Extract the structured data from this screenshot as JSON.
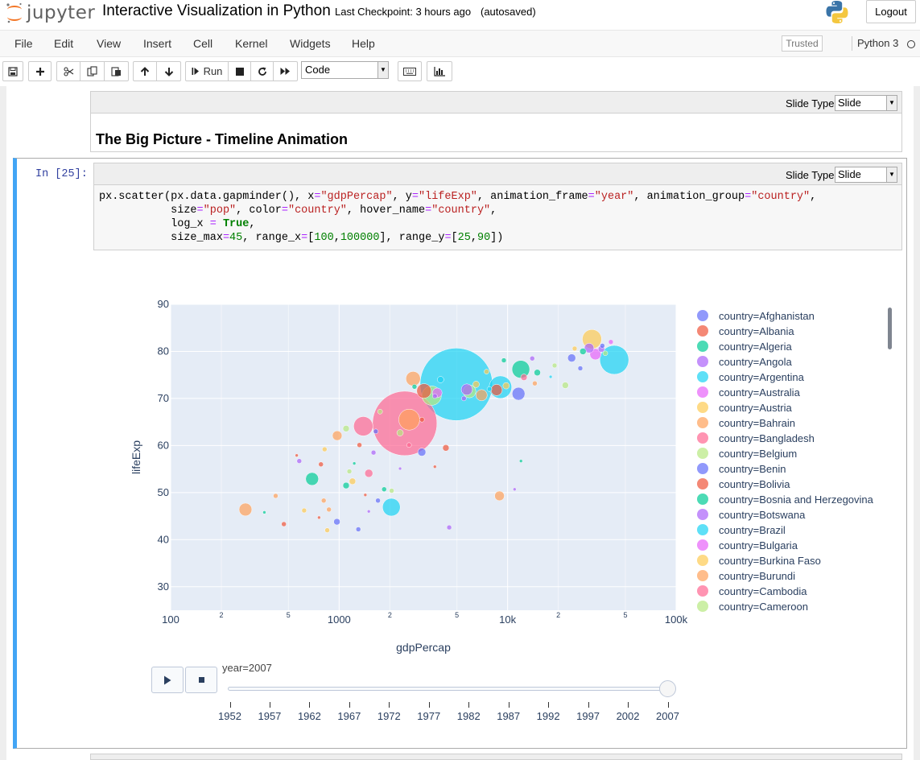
{
  "header": {
    "logo_text": "jupyter",
    "notebook_title": "Interactive Visualization in Python",
    "checkpoint": "Last Checkpoint: 3 hours ago",
    "autosave_status": "(autosaved)",
    "logout_label": "Logout"
  },
  "menubar": {
    "items": [
      "File",
      "Edit",
      "View",
      "Insert",
      "Cell",
      "Kernel",
      "Widgets",
      "Help"
    ],
    "trusted_label": "Trusted",
    "kernel_name": "Python 3"
  },
  "toolbar": {
    "run_label": "Run",
    "cell_type": "Code",
    "icons": [
      "save-icon",
      "plus-icon",
      "cut-icon",
      "copy-icon",
      "paste-icon",
      "arrow-up-icon",
      "arrow-down-icon",
      "step-forward-icon",
      "stop-icon",
      "restart-icon",
      "fast-forward-icon",
      "keyboard-icon",
      "bar-chart-icon"
    ]
  },
  "cells": {
    "markdown": {
      "slide_label": "Slide Type",
      "slide_value": "Slide",
      "heading": "The Big Picture - Timeline Animation"
    },
    "code": {
      "prompt": "In [25]:",
      "slide_label": "Slide Type",
      "slide_value": "Slide",
      "lines": [
        [
          [
            "",
            "px.scatter(px.data.gapminder(), x"
          ],
          [
            "op",
            "="
          ],
          [
            "str",
            "\"gdpPercap\""
          ],
          [
            "",
            ", y"
          ],
          [
            "op",
            "="
          ],
          [
            "str",
            "\"lifeExp\""
          ],
          [
            "",
            ", animation_frame"
          ],
          [
            "op",
            "="
          ],
          [
            "str",
            "\"year\""
          ],
          [
            "",
            ", animation_group"
          ],
          [
            "op",
            "="
          ],
          [
            "str",
            "\"country\""
          ],
          [
            "",
            ","
          ]
        ],
        [
          [
            "",
            "           size"
          ],
          [
            "op",
            "="
          ],
          [
            "str",
            "\"pop\""
          ],
          [
            "",
            ", color"
          ],
          [
            "op",
            "="
          ],
          [
            "str",
            "\"country\""
          ],
          [
            "",
            ", hover_name"
          ],
          [
            "op",
            "="
          ],
          [
            "str",
            "\"country\""
          ],
          [
            "",
            ","
          ]
        ],
        [
          [
            "",
            "           log_x "
          ],
          [
            "op",
            "="
          ],
          [
            "",
            " "
          ],
          [
            "kw",
            "True"
          ],
          [
            "",
            ","
          ]
        ],
        [
          [
            "",
            "           size_max"
          ],
          [
            "op",
            "="
          ],
          [
            "num",
            "45"
          ],
          [
            "",
            ", range_x"
          ],
          [
            "op",
            "="
          ],
          [
            "",
            "["
          ],
          [
            "num",
            "100"
          ],
          [
            "",
            ","
          ],
          [
            "num",
            "100000"
          ],
          [
            "",
            "], range_y"
          ],
          [
            "op",
            "="
          ],
          [
            "",
            "["
          ],
          [
            "num",
            "25"
          ],
          [
            "",
            ","
          ],
          [
            "num",
            "90"
          ],
          [
            "",
            "])"
          ]
        ]
      ]
    }
  },
  "chart_data": {
    "type": "scatter",
    "xlabel": "gdpPercap",
    "ylabel": "lifeExp",
    "x_scale": "log",
    "xlim": [
      100,
      100000
    ],
    "ylim": [
      25,
      90
    ],
    "x_major_ticks": [
      100,
      1000,
      10000,
      100000
    ],
    "x_major_tick_labels": [
      "100",
      "1000",
      "10k",
      "100k"
    ],
    "x_minor_ticks": [
      200,
      500,
      2000,
      5000,
      20000,
      50000
    ],
    "x_minor_tick_labels": [
      "2",
      "5",
      "2",
      "5",
      "2",
      "5"
    ],
    "y_ticks": [
      30,
      40,
      50,
      60,
      70,
      80,
      90
    ],
    "grid": true,
    "legend_placement": "right",
    "legend": [
      {
        "name": "country=Afghanistan",
        "color": "#636efa"
      },
      {
        "name": "country=Albania",
        "color": "#ef553b"
      },
      {
        "name": "country=Algeria",
        "color": "#00cc96"
      },
      {
        "name": "country=Angola",
        "color": "#ab63fa"
      },
      {
        "name": "country=Argentina",
        "color": "#19d3f3"
      },
      {
        "name": "country=Australia",
        "color": "#e763fa"
      },
      {
        "name": "country=Austria",
        "color": "#fecb52"
      },
      {
        "name": "country=Bahrain",
        "color": "#ffa15a"
      },
      {
        "name": "country=Bangladesh",
        "color": "#ff6692"
      },
      {
        "name": "country=Belgium",
        "color": "#b6e880"
      },
      {
        "name": "country=Benin",
        "color": "#636efa"
      },
      {
        "name": "country=Bolivia",
        "color": "#ef553b"
      },
      {
        "name": "country=Bosnia and Herzegovina",
        "color": "#00cc96"
      },
      {
        "name": "country=Botswana",
        "color": "#ab63fa"
      },
      {
        "name": "country=Brazil",
        "color": "#19d3f3"
      },
      {
        "name": "country=Bulgaria",
        "color": "#e763fa"
      },
      {
        "name": "country=Burkina Faso",
        "color": "#fecb52"
      },
      {
        "name": "country=Burundi",
        "color": "#ffa15a"
      },
      {
        "name": "country=Cambodia",
        "color": "#ff6692"
      },
      {
        "name": "country=Cameroon",
        "color": "#b6e880"
      }
    ],
    "points": [
      {
        "x": 4959,
        "y": 73.0,
        "s": 45,
        "c": "#19d3f3"
      },
      {
        "x": 2452,
        "y": 64.7,
        "s": 40,
        "c": "#ff6692"
      },
      {
        "x": 42952,
        "y": 78.2,
        "s": 18,
        "c": "#19d3f3"
      },
      {
        "x": 9065,
        "y": 72.4,
        "s": 14,
        "c": "#19d3f3"
      },
      {
        "x": 2605,
        "y": 65.5,
        "s": 13,
        "c": "#ffa15a"
      },
      {
        "x": 31656,
        "y": 82.6,
        "s": 12,
        "c": "#fecb52"
      },
      {
        "x": 3540,
        "y": 70.6,
        "s": 12,
        "c": "#b6e880"
      },
      {
        "x": 1391,
        "y": 64.1,
        "s": 12,
        "c": "#ff6692"
      },
      {
        "x": 11977,
        "y": 76.2,
        "s": 11,
        "c": "#00cc96"
      },
      {
        "x": 2042,
        "y": 46.9,
        "s": 11,
        "c": "#19d3f3"
      },
      {
        "x": 278,
        "y": 46.4,
        "s": 8,
        "c": "#ffa15a"
      },
      {
        "x": 2749,
        "y": 74.2,
        "s": 9,
        "c": "#ffa15a"
      },
      {
        "x": 11605,
        "y": 71.0,
        "s": 8,
        "c": "#636efa"
      },
      {
        "x": 691,
        "y": 52.9,
        "s": 8,
        "c": "#00cc96"
      },
      {
        "x": 3190,
        "y": 71.6,
        "s": 9,
        "c": "#ef553b"
      },
      {
        "x": 5937,
        "y": 71.5,
        "s": 8,
        "c": "#b6e880"
      },
      {
        "x": 7006,
        "y": 70.7,
        "s": 7,
        "c": "#ffa15a"
      },
      {
        "x": 33203,
        "y": 79.4,
        "s": 7,
        "c": "#e763fa"
      },
      {
        "x": 30470,
        "y": 80.7,
        "s": 6,
        "c": "#ab63fa"
      },
      {
        "x": 8605,
        "y": 71.8,
        "s": 7,
        "c": "#ef553b"
      },
      {
        "x": 974,
        "y": 62.1,
        "s": 6,
        "c": "#ffa15a"
      },
      {
        "x": 8948,
        "y": 49.3,
        "s": 6,
        "c": "#ffa15a"
      },
      {
        "x": 3822,
        "y": 71.2,
        "s": 6,
        "c": "#e763fa"
      },
      {
        "x": 5728,
        "y": 71.9,
        "s": 7,
        "c": "#ab63fa"
      },
      {
        "x": 24000,
        "y": 78.6,
        "s": 5,
        "c": "#636efa"
      },
      {
        "x": 3095,
        "y": 58.6,
        "s": 5,
        "c": "#636efa"
      },
      {
        "x": 4300,
        "y": 59.5,
        "s": 4,
        "c": "#ef553b"
      },
      {
        "x": 1100,
        "y": 51.5,
        "s": 4,
        "c": "#00cc96"
      },
      {
        "x": 1500,
        "y": 54.1,
        "s": 5,
        "c": "#ff6692"
      },
      {
        "x": 1200,
        "y": 52.4,
        "s": 4,
        "c": "#fecb52"
      },
      {
        "x": 1750,
        "y": 67.2,
        "s": 3,
        "c": "#b6e880"
      },
      {
        "x": 1100,
        "y": 63.6,
        "s": 4,
        "c": "#b6e880"
      },
      {
        "x": 2300,
        "y": 62.7,
        "s": 4,
        "c": "#b6e880"
      },
      {
        "x": 970,
        "y": 43.8,
        "s": 4,
        "c": "#636efa"
      },
      {
        "x": 1300,
        "y": 42.2,
        "s": 3,
        "c": "#636efa"
      },
      {
        "x": 850,
        "y": 42.0,
        "s": 3,
        "c": "#fecb52"
      },
      {
        "x": 1700,
        "y": 48.3,
        "s": 3,
        "c": "#636efa"
      },
      {
        "x": 2050,
        "y": 50.4,
        "s": 3,
        "c": "#b6e880"
      },
      {
        "x": 1600,
        "y": 58.5,
        "s": 3,
        "c": "#ab63fa"
      },
      {
        "x": 4500,
        "y": 42.6,
        "s": 3,
        "c": "#ab63fa"
      },
      {
        "x": 4000,
        "y": 74.0,
        "s": 4,
        "c": "#19d3f3"
      },
      {
        "x": 6500,
        "y": 73.0,
        "s": 4,
        "c": "#fecb52"
      },
      {
        "x": 9800,
        "y": 72.7,
        "s": 4,
        "c": "#fecb52"
      },
      {
        "x": 12500,
        "y": 74.5,
        "s": 4,
        "c": "#ff6692"
      },
      {
        "x": 14000,
        "y": 78.5,
        "s": 3,
        "c": "#ab63fa"
      },
      {
        "x": 15000,
        "y": 75.5,
        "s": 4,
        "c": "#00cc96"
      },
      {
        "x": 22000,
        "y": 72.8,
        "s": 4,
        "c": "#b6e880"
      },
      {
        "x": 28000,
        "y": 80.0,
        "s": 4,
        "c": "#00cc96"
      },
      {
        "x": 36000,
        "y": 80.5,
        "s": 4,
        "c": "#ab63fa"
      },
      {
        "x": 36500,
        "y": 81.2,
        "s": 3,
        "c": "#636efa"
      },
      {
        "x": 27000,
        "y": 76.4,
        "s": 3,
        "c": "#636efa"
      },
      {
        "x": 18000,
        "y": 74.6,
        "s": 2,
        "c": "#19d3f3"
      },
      {
        "x": 5500,
        "y": 70.0,
        "s": 3,
        "c": "#ab63fa"
      },
      {
        "x": 3700,
        "y": 70.5,
        "s": 3,
        "c": "#ab63fa"
      },
      {
        "x": 820,
        "y": 59.2,
        "s": 3,
        "c": "#fecb52"
      },
      {
        "x": 580,
        "y": 56.7,
        "s": 3,
        "c": "#ab63fa"
      },
      {
        "x": 780,
        "y": 56.0,
        "s": 3,
        "c": "#ef553b"
      },
      {
        "x": 470,
        "y": 43.3,
        "s": 3,
        "c": "#ef553b"
      },
      {
        "x": 760,
        "y": 44.7,
        "s": 2,
        "c": "#ef553b"
      },
      {
        "x": 870,
        "y": 46.4,
        "s": 3,
        "c": "#ffa15a"
      },
      {
        "x": 810,
        "y": 48.3,
        "s": 3,
        "c": "#ffa15a"
      },
      {
        "x": 420,
        "y": 49.3,
        "s": 3,
        "c": "#ffa15a"
      },
      {
        "x": 620,
        "y": 46.2,
        "s": 3,
        "c": "#fecb52"
      },
      {
        "x": 1150,
        "y": 54.5,
        "s": 3,
        "c": "#b6e880"
      },
      {
        "x": 1320,
        "y": 60.1,
        "s": 3,
        "c": "#ef553b"
      },
      {
        "x": 1650,
        "y": 63.0,
        "s": 3,
        "c": "#636efa"
      },
      {
        "x": 1850,
        "y": 50.7,
        "s": 3,
        "c": "#00cc96"
      },
      {
        "x": 2600,
        "y": 60.1,
        "s": 3,
        "c": "#ff6692"
      },
      {
        "x": 2800,
        "y": 72.5,
        "s": 3,
        "c": "#00cc96"
      },
      {
        "x": 3100,
        "y": 65.5,
        "s": 3,
        "c": "#ef553b"
      },
      {
        "x": 9500,
        "y": 78.1,
        "s": 3,
        "c": "#00cc96"
      },
      {
        "x": 7500,
        "y": 75.7,
        "s": 3,
        "c": "#fecb52"
      },
      {
        "x": 19000,
        "y": 77.0,
        "s": 3,
        "c": "#b6e880"
      },
      {
        "x": 38000,
        "y": 79.6,
        "s": 3,
        "c": "#b6e880"
      },
      {
        "x": 41000,
        "y": 82.0,
        "s": 3,
        "c": "#e763fa"
      },
      {
        "x": 25000,
        "y": 80.6,
        "s": 3,
        "c": "#fecb52"
      },
      {
        "x": 14500,
        "y": 73.2,
        "s": 3,
        "c": "#ffa15a"
      },
      {
        "x": 7800,
        "y": 72.0,
        "s": 3,
        "c": "#19d3f3"
      },
      {
        "x": 560,
        "y": 57.9,
        "s": 2,
        "c": "#ef553b"
      },
      {
        "x": 1230,
        "y": 56.2,
        "s": 2,
        "c": "#00cc96"
      },
      {
        "x": 1430,
        "y": 49.5,
        "s": 2,
        "c": "#ef553b"
      },
      {
        "x": 2300,
        "y": 55.1,
        "s": 2,
        "c": "#ab63fa"
      },
      {
        "x": 3700,
        "y": 55.5,
        "s": 2,
        "c": "#ef553b"
      },
      {
        "x": 360,
        "y": 45.8,
        "s": 2,
        "c": "#00cc96"
      },
      {
        "x": 11000,
        "y": 50.7,
        "s": 2,
        "c": "#ab63fa"
      },
      {
        "x": 12000,
        "y": 56.7,
        "s": 2,
        "c": "#00cc96"
      },
      {
        "x": 1500,
        "y": 46.0,
        "s": 2,
        "c": "#ab63fa"
      }
    ]
  },
  "animation": {
    "current_label": "year=2007",
    "years": [
      "1952",
      "1957",
      "1962",
      "1967",
      "1972",
      "1977",
      "1982",
      "1987",
      "1992",
      "1997",
      "2002",
      "2007"
    ],
    "current_index": 11,
    "play_icon": "play-icon",
    "stop_icon": "stop-icon"
  }
}
